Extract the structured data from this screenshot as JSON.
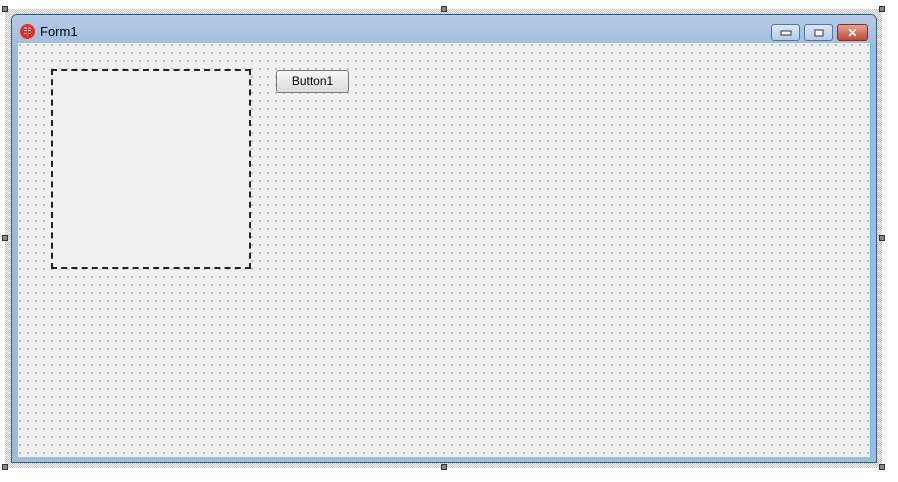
{
  "window": {
    "title": "Form1",
    "icon": "app-icon",
    "controls": [
      "minimize-icon",
      "restore-icon",
      "close-icon"
    ]
  },
  "button1": {
    "label": "Button1"
  }
}
